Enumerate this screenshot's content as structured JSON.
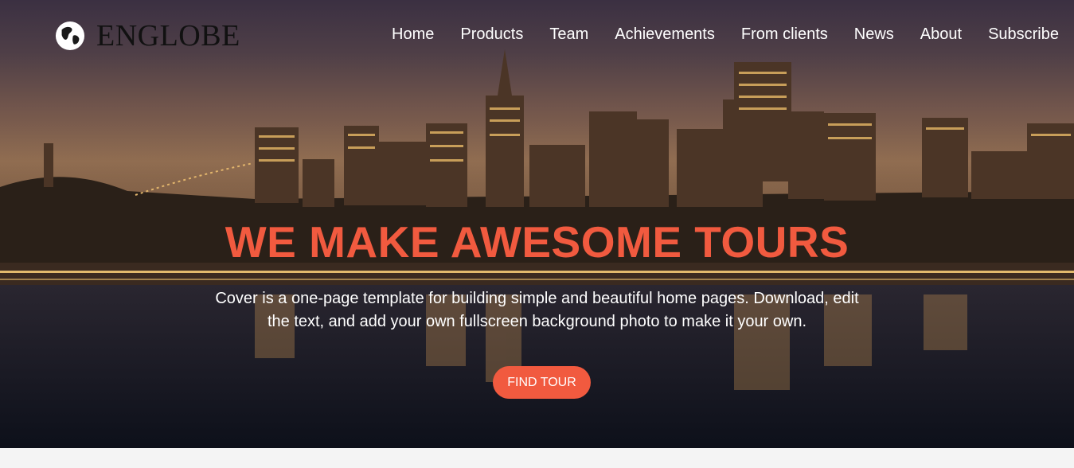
{
  "brand": {
    "name": "ENGLOBE",
    "icon": "globe-icon"
  },
  "nav": {
    "items": [
      "Home",
      "Products",
      "Team",
      "Achievements",
      "From clients",
      "News",
      "About",
      "Subscribe"
    ]
  },
  "hero": {
    "headline": "WE MAKE AWESOME TOURS",
    "lead_line_1": "Cover is a one-page template for building simple and beautiful home pages. Download, edit",
    "lead_line_2": "the text, and add your own fullscreen background photo to make it your own.",
    "cta_label": "FIND TOUR",
    "background": "night-city-skyline-photo"
  },
  "colors": {
    "accent": "#f15a3f",
    "nav_text": "#ffffff",
    "brand_text": "#111111"
  }
}
